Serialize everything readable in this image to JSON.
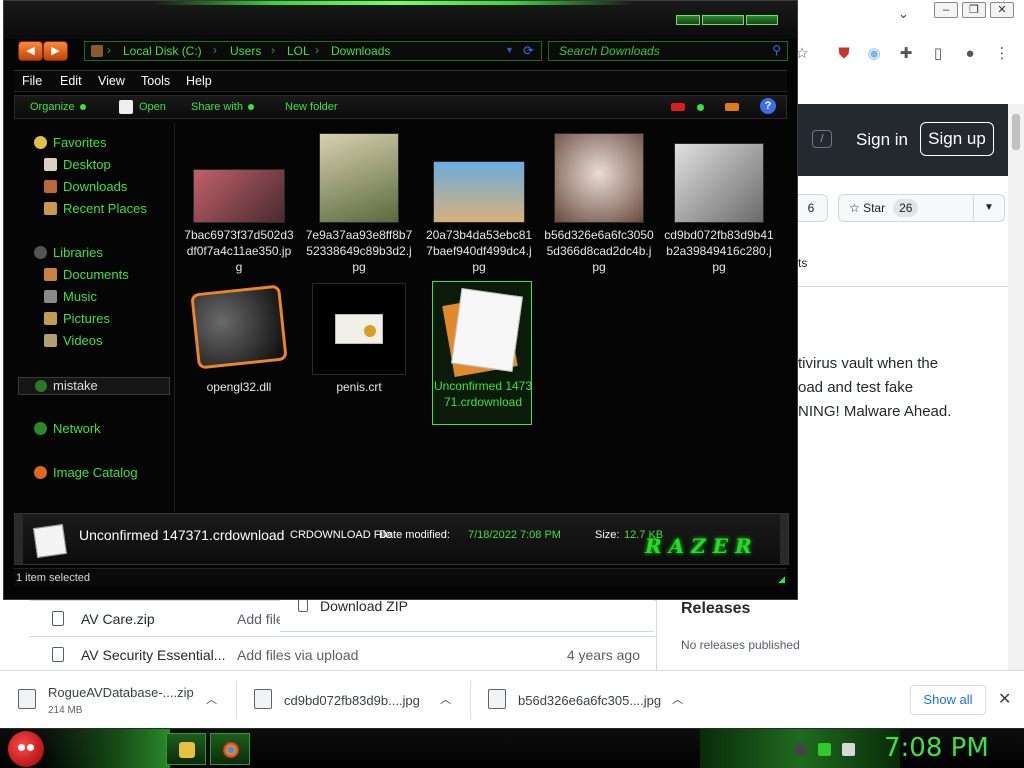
{
  "browser": {
    "sign_in": "Sign in",
    "sign_up": "Sign up",
    "slash_key": "/",
    "fork_count": "6",
    "star_label": "Star",
    "star_count": "26",
    "tab_fragment": "ts",
    "readme_lines": [
      "tivirus vault when the",
      "oad and test fake",
      "NING! Malware Ahead."
    ],
    "download_zip": "Download ZIP",
    "releases_title": "Releases",
    "no_releases": "No releases published",
    "files": [
      {
        "name": "AV Care.zip",
        "message": "Add file",
        "date": ""
      },
      {
        "name": "AV Security Essential...",
        "message": "Add files via upload",
        "date": "4 years ago"
      }
    ],
    "downloads": [
      {
        "name": "RogueAVDatabase-....zip",
        "size": "214 MB"
      },
      {
        "name": "cd9bd072fb83d9b....jpg",
        "size": ""
      },
      {
        "name": "b56d326e6a6fc305....jpg",
        "size": ""
      }
    ],
    "show_all": "Show all"
  },
  "explorer": {
    "breadcrumb": [
      "Local Disk (C:)",
      "Users",
      "LOL",
      "Downloads"
    ],
    "search_placeholder": "Search Downloads",
    "menu": [
      "File",
      "Edit",
      "View",
      "Tools",
      "Help"
    ],
    "commands": {
      "organize": "Organize",
      "open": "Open",
      "share_with": "Share with",
      "new_folder": "New folder"
    },
    "nav": {
      "favorites": "Favorites",
      "desktop": "Desktop",
      "downloads": "Downloads",
      "recent_places": "Recent Places",
      "libraries": "Libraries",
      "documents": "Documents",
      "music": "Music",
      "pictures": "Pictures",
      "videos": "Videos",
      "mistake": "mistake",
      "network": "Network",
      "image_catalog": "Image Catalog"
    },
    "files": [
      {
        "label": "7bac6973f37d502d3df0f7a4c11ae350.jpg",
        "color_a": "#c0606a",
        "color_b": "#4a2a30"
      },
      {
        "label": "7e9a37aa93e8ff8b752338649c89b3d2.jpg",
        "color_a": "#b8a888",
        "color_b": "#5a6a3a"
      },
      {
        "label": "20a73b4da53ebc817baef940df499dc4.jpg",
        "color_a": "#6aaede",
        "color_b": "#d8b07a"
      },
      {
        "label": "b56d326e6a6fc30505d366d8cad2dc4b.jpg",
        "color_a": "#d8c8c0",
        "color_b": "#6a4a40"
      },
      {
        "label": "cd9bd072fb83d9b41b2a39849416c280.jpg",
        "color_a": "#c8c8c8",
        "color_b": "#6a6a6a"
      },
      {
        "label": "opengl32.dll"
      },
      {
        "label": "penis.crt"
      },
      {
        "label": "Unconfirmed 147371.crdownload"
      }
    ],
    "details": {
      "name": "Unconfirmed 147371.crdownload",
      "type": "CRDOWNLOAD File",
      "date_label": "Date modified:",
      "date": "7/18/2022 7:08 PM",
      "size_label": "Size:",
      "size": "12.7 KB",
      "brand": "RAZER"
    },
    "status": "1 item selected"
  },
  "taskbar": {
    "clock": "7:08 PM"
  },
  "colors": {
    "accent_green": "#3fe03f",
    "explorer_bg": "#050505",
    "github_header": "#24292f"
  }
}
